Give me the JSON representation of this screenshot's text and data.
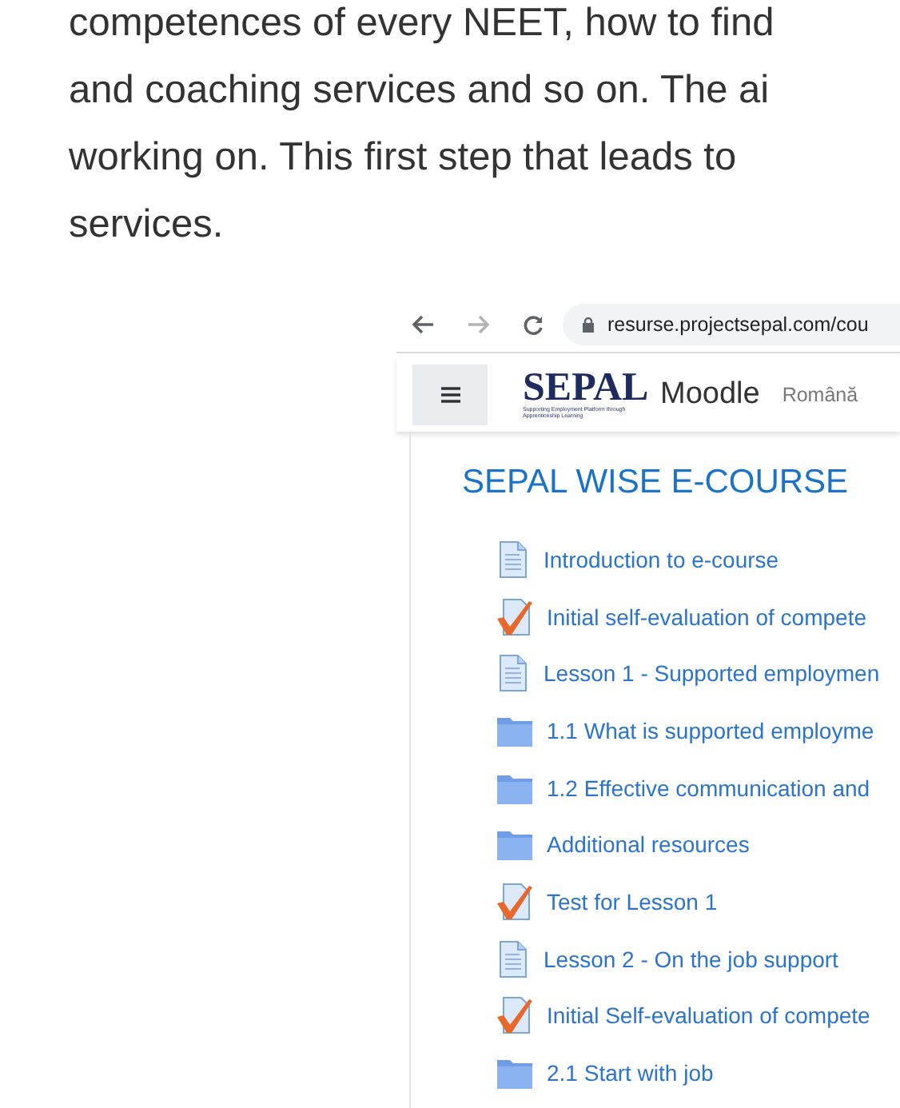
{
  "article": {
    "lines": [
      "competences of every NEET, how to find",
      "and coaching services and so on. The ai",
      "working on. This first step that leads to",
      "services."
    ]
  },
  "screenshot": {
    "browser": {
      "url": "resurse.projectsepal.com/cou"
    },
    "header": {
      "logo": "SEPAL",
      "logo_tagline": "Supporting Employment Platform through Apprenticeship Learning",
      "site": "Moodle",
      "language": "Română"
    },
    "course_title": "SEPAL WISE E-COURSE",
    "items": [
      {
        "kind": "page",
        "label": "Introduction to e-course"
      },
      {
        "kind": "quiz",
        "label": "Initial self-evaluation of compete"
      },
      {
        "kind": "page",
        "label": "Lesson 1 - Supported employmen"
      },
      {
        "kind": "folder",
        "label": "1.1 What is supported employme"
      },
      {
        "kind": "folder",
        "label": "1.2 Effective communication and"
      },
      {
        "kind": "folder",
        "label": "Additional resources"
      },
      {
        "kind": "quiz",
        "label": "Test for Lesson 1"
      },
      {
        "kind": "page",
        "label": "Lesson 2 - On the job support"
      },
      {
        "kind": "quiz",
        "label": "Initial Self-evaluation of compete"
      },
      {
        "kind": "folder",
        "label": "2.1 Start with job"
      }
    ]
  }
}
